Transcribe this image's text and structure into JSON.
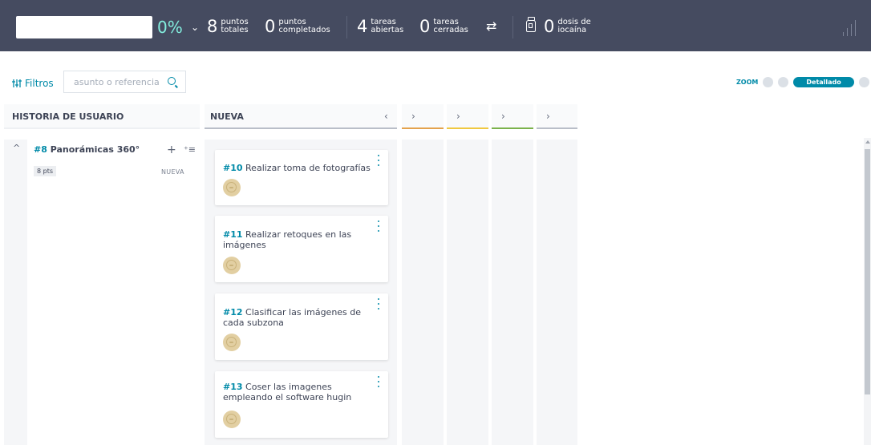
{
  "stats": {
    "progress": "0%",
    "expand_caret": "⌄",
    "total_points": {
      "value": "8",
      "line1": "puntos",
      "line2": "totales"
    },
    "completed_points": {
      "value": "0",
      "line1": "puntos",
      "line2": "completados"
    },
    "open_tasks": {
      "value": "4",
      "line1": "tareas",
      "line2": "abiertas"
    },
    "closed_tasks": {
      "value": "0",
      "line1": "tareas",
      "line2": "cerradas"
    },
    "swap_icon": "⇄",
    "iocaine": {
      "value": "0",
      "line1": "dosis de",
      "line2": "iocaína"
    }
  },
  "filters": {
    "label": "Filtros",
    "search_placeholder": "asunto o referencia"
  },
  "zoom": {
    "label": "ZOOM",
    "active": "Detallado"
  },
  "board": {
    "user_story_header": "HISTORIA DE USUARIO",
    "status_header": "NUEVA",
    "collapse_arrow": "‹",
    "expand_arrow": "›",
    "status_colors": [
      "#b9bec8",
      "#e4a24c",
      "#f0c840",
      "#7bb24b",
      "#b9bec8"
    ]
  },
  "story": {
    "ref": "#8",
    "title": "Panorámicas 360°",
    "caret": "^",
    "add": "+",
    "bulk_add": "⁺≡",
    "points": "8 pts",
    "status": "NUEVA"
  },
  "tasks": [
    {
      "ref": "#10",
      "title": "Realizar toma de fotografías"
    },
    {
      "ref": "#11",
      "title": "Realizar retoques en las imágenes"
    },
    {
      "ref": "#12",
      "title": "Clasificar las imágenes de cada subzona"
    },
    {
      "ref": "#13",
      "title": "Coser las imagenes empleando el software hugin"
    }
  ]
}
